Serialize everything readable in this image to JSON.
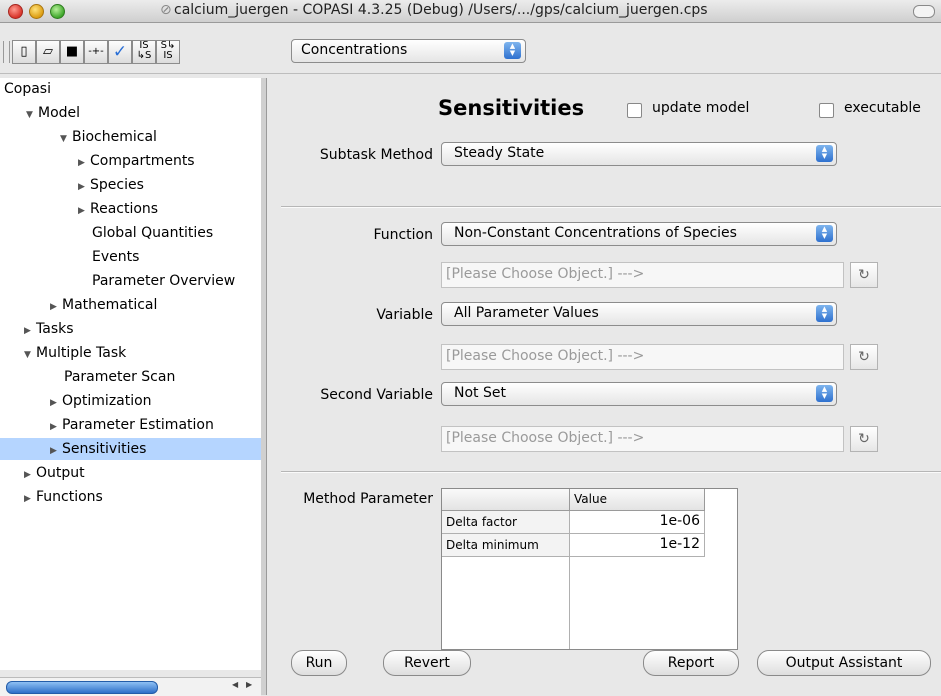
{
  "window": {
    "title": "calcium_juergen - COPASI 4.3.25 (Debug) /Users/.../gps/calcium_juergen.cps"
  },
  "toolbar": {
    "new_icon": "new-document-icon",
    "open_icon": "open-folder-icon",
    "save_icon": "save-disk-icon",
    "model_icon": "reaction-icon",
    "check_icon": "check-icon",
    "is_s_label": "IS",
    "is_s_sub": "S",
    "s_is_label": "S",
    "s_is_sub": "IS",
    "units_selected": "Concentrations"
  },
  "tree": {
    "root": "Copasi",
    "items": [
      {
        "label": "Model",
        "expander": "▼"
      },
      {
        "label": "Biochemical",
        "expander": "▼"
      },
      {
        "label": "Compartments",
        "expander": "▶"
      },
      {
        "label": "Species",
        "expander": "▶"
      },
      {
        "label": "Reactions",
        "expander": "▶"
      },
      {
        "label": "Global Quantities",
        "expander": ""
      },
      {
        "label": "Events",
        "expander": ""
      },
      {
        "label": "Parameter Overview",
        "expander": ""
      },
      {
        "label": "Mathematical",
        "expander": "▶"
      },
      {
        "label": "Tasks",
        "expander": "▶"
      },
      {
        "label": "Multiple Task",
        "expander": "▼"
      },
      {
        "label": "Parameter Scan",
        "expander": ""
      },
      {
        "label": "Optimization",
        "expander": "▶"
      },
      {
        "label": "Parameter Estimation",
        "expander": "▶"
      },
      {
        "label": "Sensitivities",
        "expander": "▶"
      },
      {
        "label": "Output",
        "expander": "▶"
      },
      {
        "label": "Functions",
        "expander": "▶"
      }
    ]
  },
  "main": {
    "heading": "Sensitivities",
    "update_model_label": "update model",
    "executable_label": "executable",
    "subtask_label": "Subtask Method",
    "subtask_value": "Steady State",
    "function_label": "Function",
    "function_value": "Non-Constant Concentrations of Species",
    "variable_label": "Variable",
    "variable_value": "All Parameter Values",
    "second_variable_label": "Second Variable",
    "second_variable_value": "Not Set",
    "choose_placeholder": "[Please Choose Object.] --->",
    "method_parameter_label": "Method Parameter",
    "table_header_value": "Value",
    "params": [
      {
        "name": "Delta factor",
        "value": "1e-06"
      },
      {
        "name": "Delta minimum",
        "value": "1e-12"
      }
    ]
  },
  "buttons": {
    "run": "Run",
    "revert": "Revert",
    "report": "Report",
    "output_assistant": "Output Assistant"
  }
}
